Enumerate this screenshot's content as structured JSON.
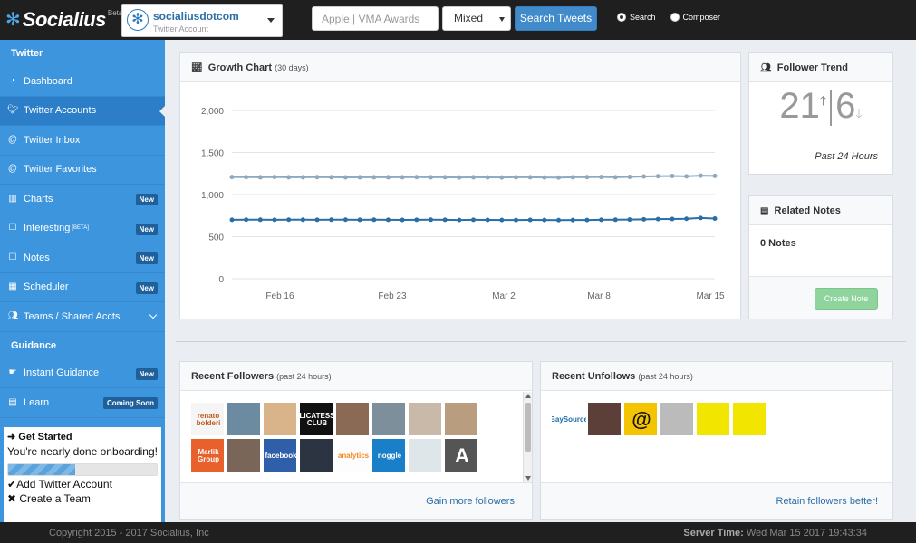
{
  "topbar": {
    "brand_name": "Socialius",
    "brand_beta": "Beta",
    "account_name": "socialiusdotcom",
    "account_sub": "Twitter Account",
    "search_placeholder": "Apple | VMA Awards",
    "result_type": "Mixed",
    "search_button": "Search Tweets",
    "radio_search": "Search",
    "radio_composer": "Composer"
  },
  "sidebar": {
    "twitter_heading": "Twitter",
    "items": [
      {
        "label": "Dashboard",
        "icon": "dashboard-icon"
      },
      {
        "label": "Twitter Accounts",
        "icon": "twitter-icon"
      },
      {
        "label": "Twitter Inbox",
        "icon": "at-icon"
      },
      {
        "label": "Twitter Favorites",
        "icon": "at-icon"
      },
      {
        "label": "Charts",
        "icon": "bar-chart-icon",
        "badge": "New"
      },
      {
        "label": "Interesting",
        "sup": "[BETA]",
        "icon": "square-icon",
        "badge": "New"
      },
      {
        "label": "Notes",
        "icon": "square-icon",
        "badge": "New"
      },
      {
        "label": "Scheduler",
        "icon": "calendar-icon",
        "badge": "New"
      },
      {
        "label": "Teams / Shared Accts",
        "icon": "users-icon"
      }
    ],
    "guidance_heading": "Guidance",
    "guidance_items": [
      {
        "label": "Instant Guidance",
        "icon": "hand-icon",
        "badge": "New"
      },
      {
        "label": "Learn",
        "icon": "book-icon",
        "badge": "Coming Soon"
      }
    ],
    "onboard": {
      "title": "Get Started",
      "text": "You're nearly done onboarding!",
      "progress": 0.45,
      "task_done": "Add Twitter Account",
      "task_todo": "Create a Team"
    }
  },
  "growth_panel": {
    "title": "Growth Chart",
    "subtitle": "(30 days)"
  },
  "chart_data": {
    "type": "line",
    "title": "",
    "xlabel": "",
    "ylabel": "",
    "ylim": [
      0,
      2000
    ],
    "y_ticks": [
      "0",
      "500",
      "1,000",
      "1,500",
      "2,000"
    ],
    "x_ticks": [
      "Feb 16",
      "Feb 23",
      "Mar 2",
      "Mar 8",
      "Mar 15"
    ],
    "grid": true,
    "series": [
      {
        "color": "#8fa9bf",
        "values": [
          1208,
          1207,
          1205,
          1208,
          1206,
          1205,
          1207,
          1206,
          1204,
          1205,
          1206,
          1205,
          1206,
          1207,
          1205,
          1206,
          1203,
          1205,
          1204,
          1203,
          1205,
          1206,
          1203,
          1202,
          1205,
          1207,
          1208,
          1206,
          1210,
          1215,
          1218,
          1220,
          1216,
          1225,
          1222
        ]
      },
      {
        "color": "#2a6ea6",
        "values": [
          700,
          702,
          701,
          700,
          702,
          701,
          700,
          701,
          702,
          700,
          701,
          700,
          699,
          700,
          701,
          700,
          698,
          700,
          699,
          698,
          697,
          699,
          698,
          696,
          697,
          698,
          700,
          701,
          703,
          706,
          708,
          710,
          712,
          722,
          715
        ]
      }
    ]
  },
  "trend_panel": {
    "title": "Follower Trend",
    "up_value": "21",
    "down_value": "6",
    "footer": "Past 24 Hours"
  },
  "notes_panel": {
    "title": "Related Notes",
    "count": "0 Notes",
    "create_button": "Create Note"
  },
  "followers_panel": {
    "title": "Recent Followers",
    "subtitle": "(past 24 hours)",
    "footer_link": "Gain more followers!",
    "avatars": [
      {
        "bg": "#f5f5f5",
        "fg": "#c05a20",
        "text": "renato bolderi"
      },
      {
        "bg": "#6c8ba0",
        "fg": "#fff",
        "text": ""
      },
      {
        "bg": "#d9b48a",
        "fg": "#fff",
        "text": ""
      },
      {
        "bg": "#111",
        "fg": "#fff",
        "text": "DELICATESSEN CLUB"
      },
      {
        "bg": "#8a6a55",
        "fg": "#fff",
        "text": ""
      },
      {
        "bg": "#7e8f9c",
        "fg": "#fff",
        "text": ""
      },
      {
        "bg": "#c9b9a8",
        "fg": "#fff",
        "text": ""
      },
      {
        "bg": "#b89e7e",
        "fg": "#fff",
        "text": ""
      },
      {
        "bg": "#e8612c",
        "fg": "#fff",
        "text": "Marlik Group"
      },
      {
        "bg": "#7a6658",
        "fg": "#fff",
        "text": ""
      },
      {
        "bg": "#2f5fa8",
        "fg": "#fff",
        "text": "facebook"
      },
      {
        "bg": "#2b3440",
        "fg": "#fff",
        "text": ""
      },
      {
        "bg": "#fdfdfd",
        "fg": "#f08a24",
        "text": "analytics"
      },
      {
        "bg": "#1a7fc9",
        "fg": "#fff",
        "text": "noggle"
      },
      {
        "bg": "#dfe6ea",
        "fg": "#333",
        "text": ""
      },
      {
        "bg": "#555",
        "fg": "#fff",
        "text": "A"
      }
    ]
  },
  "unfollows_panel": {
    "title": "Recent Unfollows",
    "subtitle": "(past 24 hours)",
    "footer_link": "Retain followers better!",
    "avatars": [
      {
        "bg": "#fff",
        "fg": "#1a6ea8",
        "text": "BaySource"
      },
      {
        "bg": "#5b3f38",
        "fg": "#fff",
        "text": ""
      },
      {
        "bg": "#f5c400",
        "fg": "#111",
        "text": "@"
      },
      {
        "bg": "#bbb",
        "fg": "#fff",
        "text": ""
      },
      {
        "bg": "#f2e600",
        "fg": "#111",
        "text": ""
      },
      {
        "bg": "#f2e600",
        "fg": "#111",
        "text": ""
      }
    ]
  },
  "footer": {
    "copyright": "Copyright 2015 - 2017 Socialius, Inc",
    "server_label": "Server Time:",
    "server_time": "Wed Mar 15 2017 19:43:34"
  }
}
